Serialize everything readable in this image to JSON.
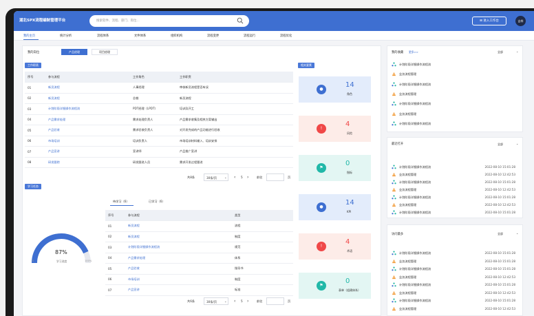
{
  "app": {
    "title": "湖北SPX流程编制管理平台",
    "avatar_label": "吉祥"
  },
  "search": {
    "placeholder": "搜索软件、流程、部门、岗位..."
  },
  "top_button": {
    "label": "进入工作台"
  },
  "nav": {
    "items": [
      "我的主页",
      "统计分析",
      "流程体系",
      "文件体系",
      "组织机构",
      "流程变更",
      "流程运行",
      "流程优化"
    ],
    "active_index": 0
  },
  "position": {
    "label": "我的岗位",
    "tabs": [
      "产品经理",
      "项目经理"
    ],
    "active_tab": 0
  },
  "duties": {
    "tag": "工作职责",
    "columns": [
      "序号",
      "参与流程",
      "工作角色",
      "工作职责"
    ],
    "rows": [
      [
        "01",
        "新员流程",
        "人事经理",
        "审核新员流程是否有误"
      ],
      [
        "02",
        "新员流程",
        "总裁",
        "新员流程"
      ],
      [
        "03",
        "计划阶段详细操作流程流",
        "PDT经理（LPDT）",
        "培训及开工"
      ],
      [
        "04",
        "产品需求处理",
        "需求处理负责人",
        "产品需求收集及相关方案输出"
      ],
      [
        "05",
        "产品验收",
        "需求验收负责人",
        "对开发完成的产品功能进行验收"
      ],
      [
        "06",
        "市场培训",
        "培训负责人",
        "市场培训材料输入、培训安排"
      ],
      [
        "07",
        "产品宣讲",
        "宣讲师",
        "产品推广宣讲"
      ],
      [
        "08",
        "研发跟踪",
        "研发跟进人员",
        "需求开发过程跟进"
      ]
    ],
    "pager": {
      "total": "共8条",
      "page_size": "30条/页",
      "page": "5",
      "goto": "前往",
      "page_suffix": "页"
    }
  },
  "learning": {
    "tag": "学习任务",
    "gauge": {
      "percent_text": "87%",
      "percent": 87,
      "sub_label": "学习进度",
      "min_label": "0",
      "max_label": "100%"
    },
    "tabs": [
      "待学习（6）",
      "已学习（6）"
    ],
    "active_tab": 0,
    "columns": [
      "序号",
      "参与流程",
      "类型"
    ],
    "rows": [
      [
        "01",
        "新员流程",
        "流程"
      ],
      [
        "02",
        "新员流程",
        "制度"
      ],
      [
        "03",
        "计划阶段详细操作流程流",
        "规范"
      ],
      [
        "04",
        "产品需求处理",
        "体系"
      ],
      [
        "05",
        "产品验收",
        "指导书"
      ],
      [
        "06",
        "市场培训",
        "制度"
      ],
      [
        "07",
        "产品宣讲",
        "标准"
      ]
    ],
    "pager": {
      "total": "共6条",
      "page_size": "30条/页",
      "page": "5",
      "goto": "前往",
      "page_suffix": "页"
    }
  },
  "related": {
    "tag": "相关要素",
    "stats": [
      {
        "value": "14",
        "label": "角色",
        "icon": "user-icon",
        "color": "#3e6fd1",
        "bg": "#e3ecfb"
      },
      {
        "value": "4",
        "label": "风险",
        "icon": "warning-icon",
        "color": "#f04848",
        "bg": "#fdece8"
      },
      {
        "value": "0",
        "label": "指标",
        "icon": "flag-icon",
        "color": "#21b8a8",
        "bg": "#e3f6f3"
      },
      {
        "value": "14",
        "label": "KPI",
        "icon": "user-icon",
        "color": "#3e6fd1",
        "bg": "#e3ecfb"
      },
      {
        "value": "4",
        "label": "术语",
        "icon": "warning-icon",
        "color": "#f04848",
        "bg": "#fdece8"
      },
      {
        "value": "0",
        "label": "表单（组建体系）",
        "icon": "flag-icon",
        "color": "#21b8a8",
        "bg": "#e3f6f3"
      }
    ]
  },
  "favorites": {
    "title": "我的收藏",
    "subtitle": "更多>>",
    "filter": "全部",
    "items": [
      {
        "name": "计划阶段详细操作流程流",
        "icon": "process-icon"
      },
      {
        "name": "业务流程管理",
        "icon": "document-icon"
      },
      {
        "name": "计划阶段详细操作流程流",
        "icon": "process-icon"
      },
      {
        "name": "业务流程管理",
        "icon": "document-icon"
      },
      {
        "name": "计划阶段详细操作流程流",
        "icon": "process-icon"
      },
      {
        "name": "业务流程管理",
        "icon": "document-icon"
      },
      {
        "name": "计划阶段详细操作流程流",
        "icon": "process-icon"
      }
    ]
  },
  "recent": {
    "title": "最近打开",
    "filter": "全部",
    "items": [
      {
        "name": "计划阶段详细操作流程流",
        "time": "2022-08-10 15:01:28",
        "icon": "process-icon"
      },
      {
        "name": "业务流程管理",
        "time": "2022-08-10 12:42:53",
        "icon": "document-icon"
      },
      {
        "name": "计划阶段详细操作流程流",
        "time": "2022-08-10 15:01:28",
        "icon": "process-icon"
      },
      {
        "name": "业务流程管理",
        "time": "2022-08-10 12:42:53",
        "icon": "document-icon"
      },
      {
        "name": "计划阶段详细操作流程流",
        "time": "2022-08-10 15:01:28",
        "icon": "process-icon"
      },
      {
        "name": "业务流程管理",
        "time": "2022-08-10 12:42:53",
        "icon": "document-icon"
      },
      {
        "name": "计划阶段详细操作流程流",
        "time": "2022-08-10 15:01:28",
        "icon": "process-icon"
      }
    ]
  },
  "visits": {
    "title": "访问最多",
    "filter": "全部",
    "items": [
      {
        "name": "计划阶段详细操作流程流",
        "time": "2022-08-10 15:01:28",
        "icon": "process-icon"
      },
      {
        "name": "业务流程管理",
        "time": "2022-08-10 15:01:28",
        "icon": "document-icon"
      },
      {
        "name": "计划阶段详细操作流程流",
        "time": "2022-08-10 15:01:28",
        "icon": "process-icon"
      },
      {
        "name": "业务流程管理",
        "time": "2022-08-10 12:42:53",
        "icon": "document-icon"
      },
      {
        "name": "计划阶段详细操作流程流",
        "time": "2022-08-10 15:01:28",
        "icon": "process-icon"
      },
      {
        "name": "业务流程管理",
        "time": "2022-08-10 12:42:53",
        "icon": "document-icon"
      },
      {
        "name": "计划阶段详细操作流程流",
        "time": "2022-08-10 15:01:28",
        "icon": "process-icon"
      },
      {
        "name": "业务流程管理",
        "time": "2022-08-10 12:42:53",
        "icon": "document-icon"
      }
    ]
  },
  "colors": {
    "brand": "#3e6fd1",
    "accent_link": "#3e6fd1"
  }
}
